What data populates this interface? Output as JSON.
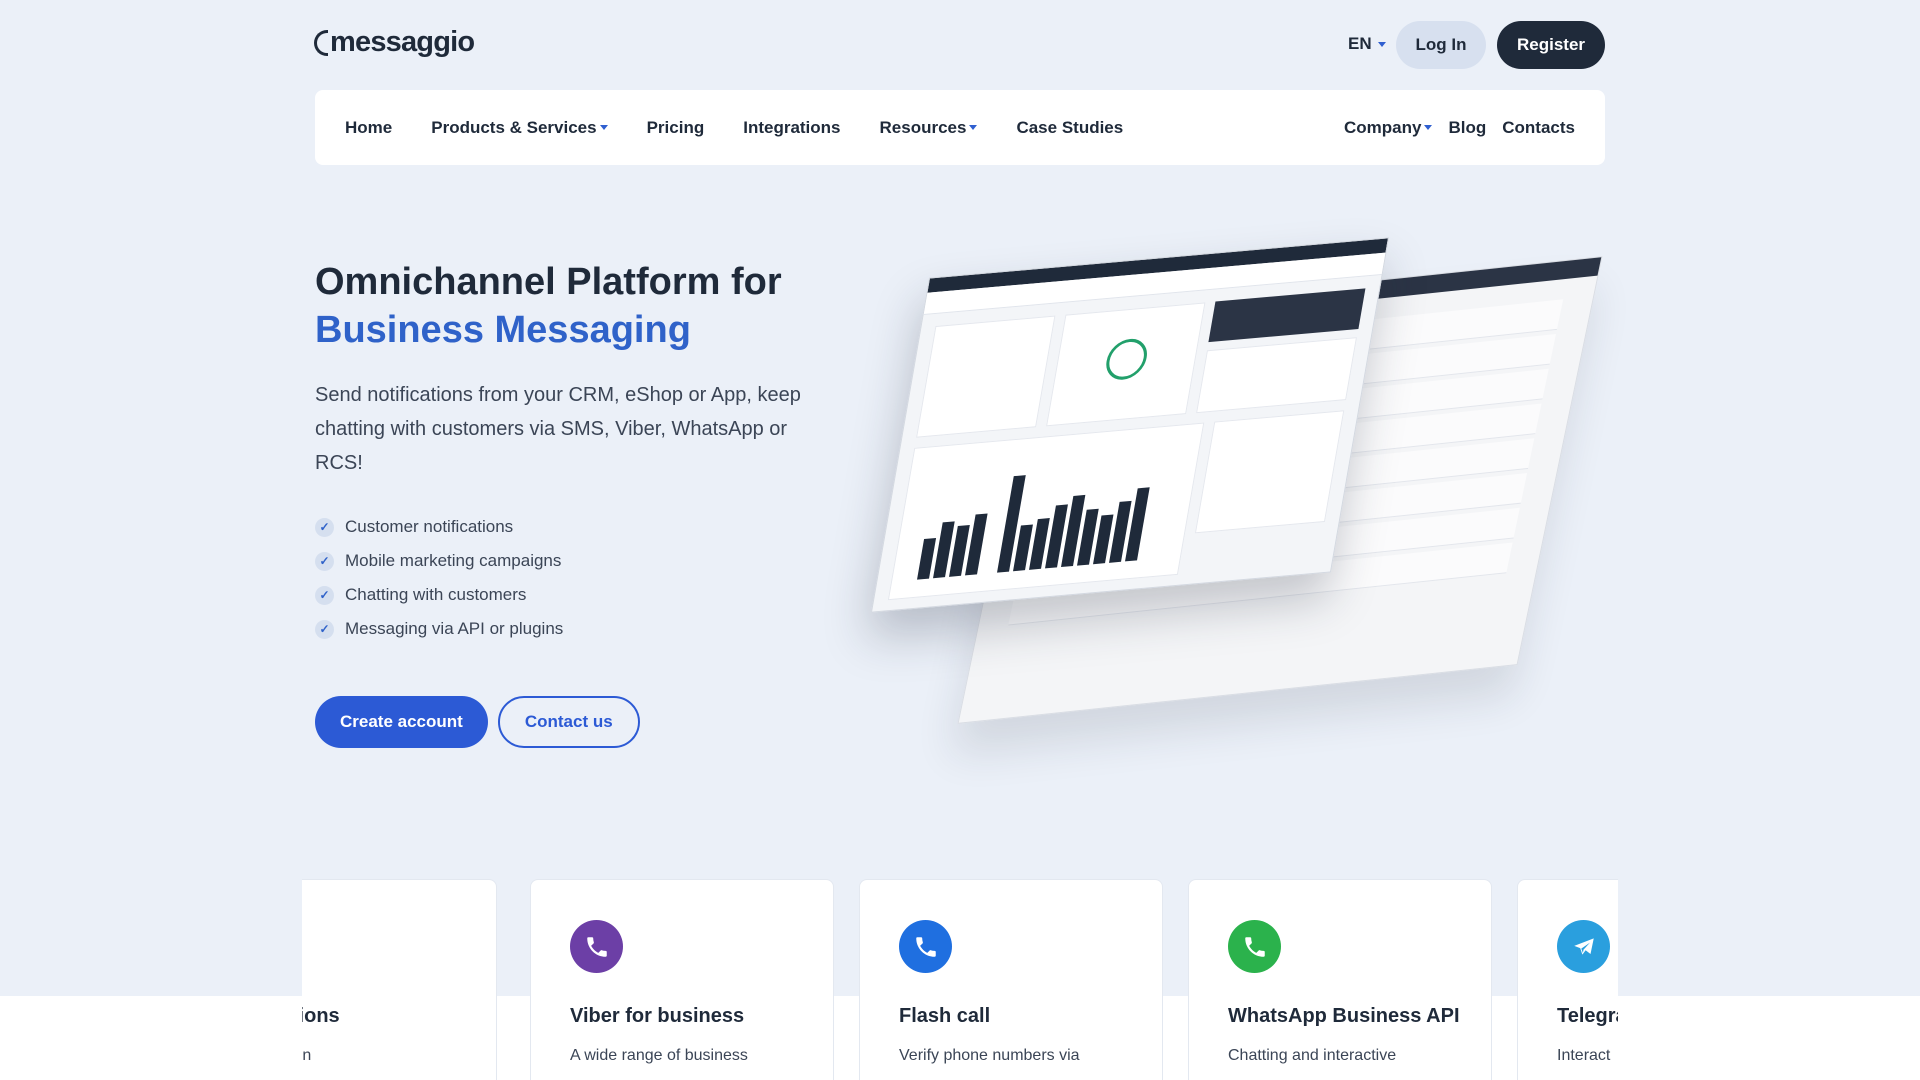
{
  "brand": {
    "name": "messaggio"
  },
  "topbar": {
    "lang": "EN",
    "login": "Log In",
    "register": "Register"
  },
  "nav": {
    "left": [
      {
        "label": "Home",
        "dropdown": false
      },
      {
        "label": "Products & Services",
        "dropdown": true
      },
      {
        "label": "Pricing",
        "dropdown": false
      },
      {
        "label": "Integrations",
        "dropdown": false
      },
      {
        "label": "Resources",
        "dropdown": true
      },
      {
        "label": "Case Studies",
        "dropdown": false
      }
    ],
    "right": [
      {
        "label": "Company",
        "dropdown": true
      },
      {
        "label": "Blog",
        "dropdown": false
      },
      {
        "label": "Contacts",
        "dropdown": false
      }
    ]
  },
  "hero": {
    "title_line1": "Omnichannel Platform for",
    "title_line2": "Business Messaging",
    "lead": "Send notifications from your CRM, eShop or App, keep chatting with customers via SMS, Viber, WhatsApp or RCS!",
    "features": [
      "Customer notifications",
      "Mobile marketing campaigns",
      "Chatting with customers",
      "Messaging via API or plugins"
    ],
    "cta_primary": "Create account",
    "cta_secondary": "Contact us"
  },
  "cards": [
    {
      "title": "otifications",
      "desc": "st common",
      "icon": "sms-icon",
      "color": "#2f62c9"
    },
    {
      "title": "Viber for business",
      "desc": "A wide range of business",
      "icon": "viber-icon",
      "color": "#6c3fa6"
    },
    {
      "title": "Flash call",
      "desc": "Verify phone numbers via",
      "icon": "phone-icon",
      "color": "#1f6fe0"
    },
    {
      "title": "WhatsApp Business API",
      "desc": "Chatting and interactive",
      "icon": "whatsapp-icon",
      "color": "#2bb24c"
    },
    {
      "title": "Telegra",
      "desc": "Interact",
      "icon": "telegram-icon",
      "color": "#2a9fde"
    }
  ],
  "colors": {
    "accent": "#2c5ad5",
    "dark": "#1f2a3a",
    "background": "#ebf0f8"
  }
}
